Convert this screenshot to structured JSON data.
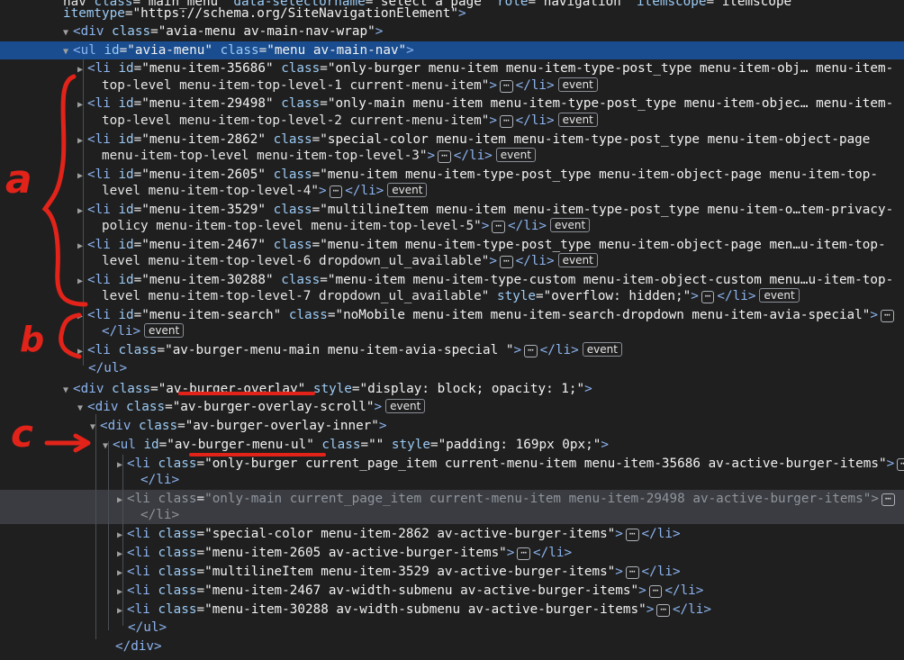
{
  "rows": [
    {
      "line": "nav class=\"main_menu\" data-selectorname=\"select a page\" role=\"navigation\" itemscope=\"itemscope\""
    },
    {
      "line": "itemtype=\"https://schema.org/SiteNavigationElement\">"
    },
    {
      "line": "<div class=\"avia-menu av-main-nav-wrap\">"
    },
    {
      "line": "<ul id=\"avia-menu\" class=\"menu av-main-nav\">"
    },
    {
      "line": "<li id=\"menu-item-35686\" class=\"only-burger menu-item menu-item-type-post_type menu-item-obj… menu-item-"
    },
    {
      "line": "top-level menu-item-top-level-1 current-menu-item\">"
    },
    {
      "line": "<li id=\"menu-item-29498\" class=\"only-main menu-item menu-item-type-post_type menu-item-objec… menu-item-"
    },
    {
      "line": "top-level menu-item-top-level-2 current-menu-item\">"
    },
    {
      "line": "<li id=\"menu-item-2862\" class=\"special-color menu-item menu-item-type-post_type menu-item-object-page"
    },
    {
      "line": "menu-item-top-level menu-item-top-level-3\">"
    },
    {
      "line": "<li id=\"menu-item-2605\" class=\"menu-item menu-item-type-post_type menu-item-object-page menu-item-top-"
    },
    {
      "line": "level menu-item-top-level-4\">"
    },
    {
      "line": "<li id=\"menu-item-3529\" class=\"multilineItem menu-item menu-item-type-post_type menu-item-o…tem-privacy-"
    },
    {
      "line": "policy menu-item-top-level menu-item-top-level-5\">"
    },
    {
      "line": "<li id=\"menu-item-2467\" class=\"menu-item menu-item-type-post_type menu-item-object-page men…u-item-top-"
    },
    {
      "line": "level menu-item-top-level-6 dropdown_ul_available\">"
    },
    {
      "line": "<li id=\"menu-item-30288\" class=\"menu-item menu-item-type-custom menu-item-object-custom menu…u-item-top-"
    },
    {
      "line": "level menu-item-top-level-7 dropdown_ul_available\" style=\"overflow: hidden;\">"
    },
    {
      "line": "<li id=\"menu-item-search\" class=\"noMobile menu-item menu-item-search-dropdown menu-item-avia-special\">"
    },
    {
      "line": "</li>"
    },
    {
      "line": "<li class=\"av-burger-menu-main menu-item-avia-special \">"
    },
    {
      "line": "</ul>"
    },
    {
      "line": "<div class=\"av-burger-overlay\" style=\"display: block; opacity: 1;\">"
    },
    {
      "line": "<div class=\"av-burger-overlay-scroll\">"
    },
    {
      "line": "<div class=\"av-burger-overlay-inner\">"
    },
    {
      "line": "<ul id=\"av-burger-menu-ul\" class=\"\" style=\"padding: 169px 0px;\">"
    },
    {
      "line": "<li class=\"only-burger current_page_item current-menu-item menu-item-35686 av-active-burger-items\">"
    },
    {
      "line": "</li>"
    },
    {
      "line": "<li class=\"only-main current_page_item current-menu-item menu-item-29498 av-active-burger-items\">"
    },
    {
      "line": "</li>"
    },
    {
      "line": "<li class=\"special-color menu-item-2862 av-active-burger-items\">"
    },
    {
      "line": "<li class=\"menu-item-2605 av-active-burger-items\">"
    },
    {
      "line": "<li class=\"multilineItem menu-item-3529 av-active-burger-items\">"
    },
    {
      "line": "<li class=\"menu-item-2467 av-width-submenu av-active-burger-items\">"
    },
    {
      "line": "<li class=\"menu-item-30288 av-width-submenu av-active-burger-items\">"
    },
    {
      "line": "</ul>"
    },
    {
      "line": "</div>"
    }
  ],
  "ellipsis": "⋯",
  "badge_label": "event",
  "close_li": "</li>",
  "annotations": {
    "a": "a",
    "b": "b",
    "c": "c"
  },
  "colors": {
    "background": "#1f1f1f",
    "selection": "#1a4d8f",
    "hover": "#3a3c41",
    "annotation": "#e2231a"
  }
}
